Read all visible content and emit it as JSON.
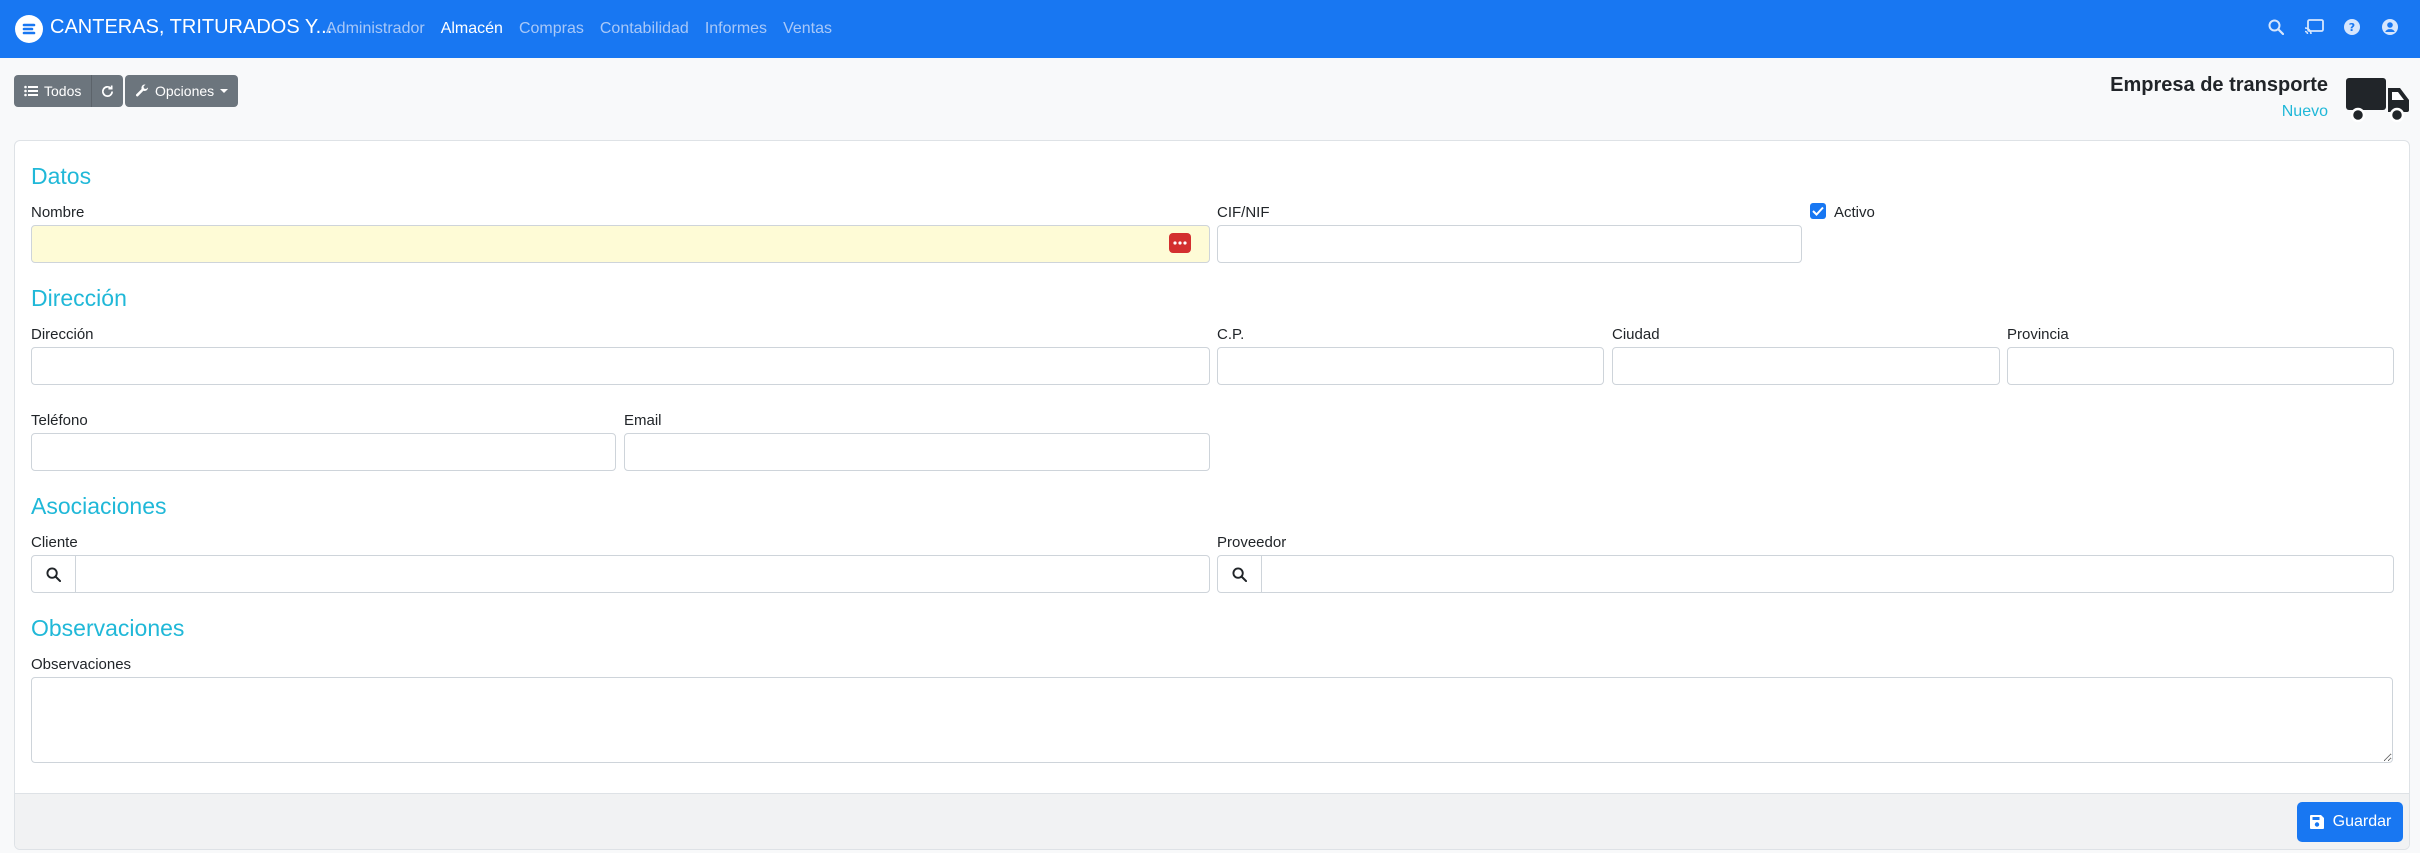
{
  "navbar": {
    "brand": "CANTERAS, TRITURADOS Y...",
    "links": [
      {
        "label": "Administrador",
        "active": false
      },
      {
        "label": "Almacén",
        "active": true
      },
      {
        "label": "Compras",
        "active": false
      },
      {
        "label": "Contabilidad",
        "active": false
      },
      {
        "label": "Informes",
        "active": false
      },
      {
        "label": "Ventas",
        "active": false
      }
    ],
    "icons": [
      "search-icon",
      "broadcast-icon",
      "help-icon",
      "user-icon"
    ],
    "color": "#1877f2"
  },
  "toolbar": {
    "all_label": "Todos",
    "options_label": "Opciones"
  },
  "header": {
    "title": "Empresa de transporte",
    "subtitle": "Nuevo"
  },
  "form": {
    "sections": {
      "datos": "Datos",
      "direccion": "Dirección",
      "asociaciones": "Asociaciones",
      "observaciones": "Observaciones"
    },
    "labels": {
      "nombre": "Nombre",
      "cifnif": "CIF/NIF",
      "activo": "Activo",
      "direccion": "Dirección",
      "cp": "C.P.",
      "ciudad": "Ciudad",
      "provincia": "Provincia",
      "telefono": "Teléfono",
      "email": "Email",
      "cliente": "Cliente",
      "proveedor": "Proveedor",
      "observaciones": "Observaciones"
    },
    "activo_checked": true
  },
  "footer": {
    "save_label": "Guardar"
  }
}
